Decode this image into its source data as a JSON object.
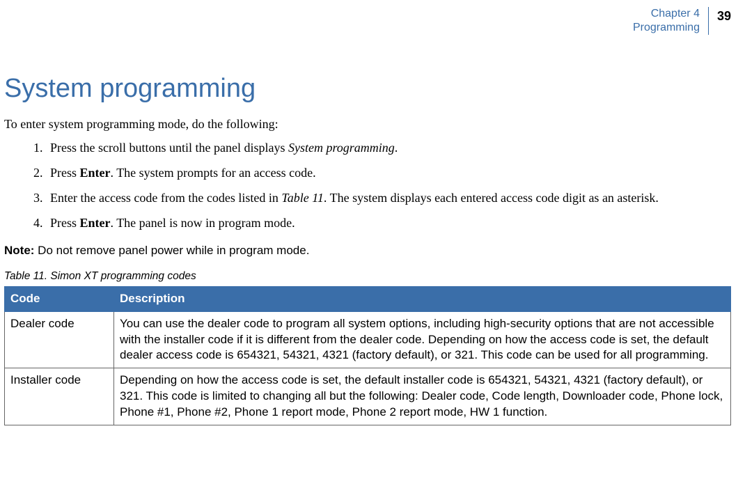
{
  "header": {
    "chapter_line": "Chapter 4",
    "section_line": "Programming",
    "page_number": "39"
  },
  "heading": "System programming",
  "intro": "To enter system programming mode, do the following:",
  "steps": {
    "s1_a": "Press the scroll buttons until the panel displays ",
    "s1_italic": "System programming",
    "s1_b": ".",
    "s2_a": "Press ",
    "s2_bold": "Enter",
    "s2_b": ".  The system prompts for an access code.",
    "s3_a": "Enter the access code from the codes listed in ",
    "s3_italic": "Table 11",
    "s3_b": ".  The system displays each entered access code digit as an asterisk.",
    "s4_a": "Press ",
    "s4_bold": "Enter",
    "s4_b": ".  The panel is now in program mode."
  },
  "note": {
    "label": "Note:",
    "text": "  Do not remove panel power while in program mode."
  },
  "table": {
    "caption": "Table 11.   Simon XT  programming codes",
    "head": {
      "col1": "Code",
      "col2": "Description"
    },
    "rows": [
      {
        "code": "Dealer code",
        "desc": "You can use the dealer code to program all system options, including high-security options that are not accessible with the installer code if it is different from the dealer code.  Depending on how the access code is set, the default dealer access code is 654321, 54321, 4321 (factory default), or 321. This code can be used for all programming."
      },
      {
        "code": "Installer code",
        "desc": "Depending on how the access code is set, the default installer code is 654321, 54321, 4321 (factory default), or 321. This code is limited to changing all but the following: Dealer code, Code length, Downloader code, Phone lock, Phone #1, Phone #2, Phone 1 report mode, Phone 2 report mode, HW 1 function."
      }
    ]
  }
}
